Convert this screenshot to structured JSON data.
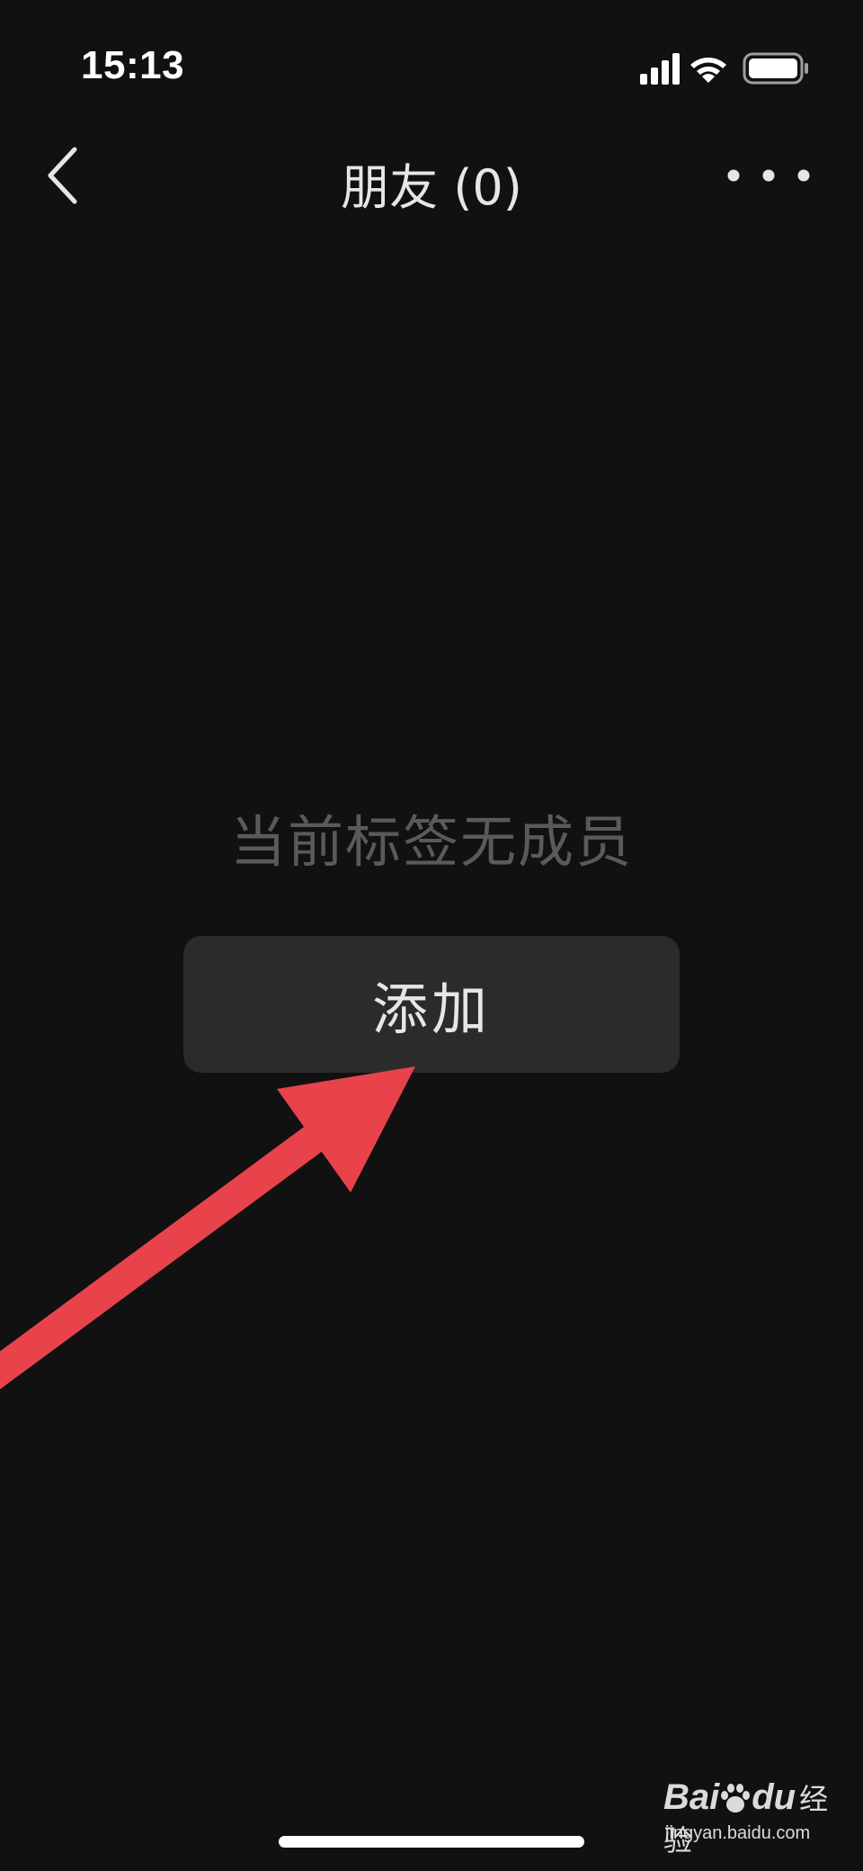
{
  "status_bar": {
    "time": "15:13",
    "icons": [
      "signal-icon",
      "wifi-icon",
      "battery-icon"
    ]
  },
  "nav": {
    "back_icon": "chevron-left-icon",
    "title": "朋友 (0)",
    "more_icon": "more-dots-icon"
  },
  "content": {
    "empty_message": "当前标签无成员",
    "add_button_label": "添加"
  },
  "annotation": {
    "arrow_color": "#e8434b"
  },
  "watermark": {
    "brand_prefix": "Bai",
    "brand_suffix": "du",
    "brand_cn": "经验",
    "url": "jingyan.baidu.com"
  },
  "colors": {
    "background": "#111112",
    "button_background": "#2b2b2b",
    "empty_text": "#5a5a5a",
    "title_text": "#e6e6e6"
  }
}
